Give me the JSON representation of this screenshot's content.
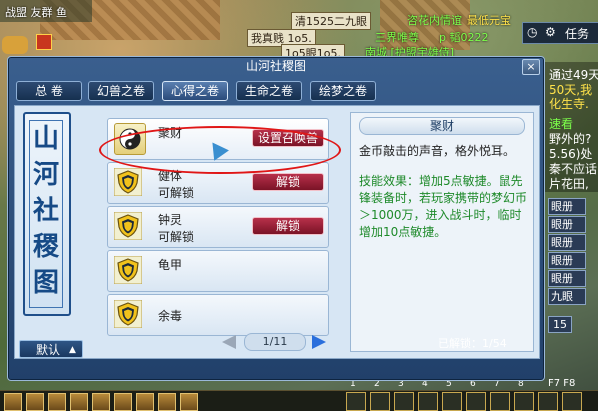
{
  "scene": {
    "top_left_text": "战盟 友群 鱼",
    "plates": [
      "清1525二九眼",
      "我真贱 1o5.",
      "1o5眼1o5."
    ],
    "green_texts": [
      "咨花内情谊",
      "三界唯尊",
      "p 韬0222",
      "南城 [护盟宇雄侍]"
    ],
    "yellow_texts": [
      "最低元宝"
    ],
    "right_panel": {
      "top_bar": [
        "任务"
      ],
      "chat_lines": [
        {
          "text": "通过49天",
          "color": "#ffffff"
        },
        {
          "text": "50天,我",
          "color": "#ffe24a"
        },
        {
          "text": "化生寺.",
          "color": "#ffe24a"
        },
        {
          "text": "速看",
          "color": "#7cff4a"
        },
        {
          "text": "野外的?",
          "color": "#ffffff"
        },
        {
          "text": "5.56)处",
          "color": "#ffffff"
        },
        {
          "text": "秦不应话",
          "color": "#ffffff"
        },
        {
          "text": "片花田,",
          "color": "#ffffff"
        }
      ],
      "quest_items": [
        "眼册",
        "眼册",
        "眼册",
        "眼册",
        "眼册",
        "九眼"
      ],
      "badge": "15",
      "fkeys": "F7 F8"
    },
    "hotbar_numbers": [
      "1",
      "2",
      "3",
      "4",
      "5",
      "6",
      "7",
      "8"
    ]
  },
  "dialog": {
    "title": "山河社稷图",
    "close_label": "×",
    "tabs": [
      {
        "label": "总 卷",
        "active": false
      },
      {
        "label": "幻兽之卷",
        "active": false
      },
      {
        "label": "心得之卷",
        "active": true
      },
      {
        "label": "生命之卷",
        "active": false
      },
      {
        "label": "绘梦之卷",
        "active": false
      }
    ],
    "banner": [
      "山",
      "河",
      "社",
      "稷",
      "图"
    ],
    "collapse_label": "默认",
    "skills": [
      {
        "name": "聚财",
        "status": "",
        "button": "设置召唤兽",
        "icon": "yinyang-icon",
        "selected": true
      },
      {
        "name": "健体",
        "status": "可解锁",
        "button": "解锁",
        "icon": "shield-icon",
        "selected": false
      },
      {
        "name": "钟灵",
        "status": "可解锁",
        "button": "解锁",
        "icon": "shield-icon",
        "selected": false
      },
      {
        "name": "龟甲",
        "status": "",
        "button": "",
        "icon": "shield-icon",
        "selected": false
      },
      {
        "name": "余毒",
        "status": "",
        "button": "",
        "icon": "shield-icon",
        "selected": false
      }
    ],
    "detail": {
      "title": "聚财",
      "description": "金币敲击的声音，格外悦耳。",
      "effect": "技能效果：增加5点敏捷。鼠先锋装备时，若玩家携带的梦幻币＞1000万，进入战斗时，临时增加10点敏捷。"
    },
    "pager": {
      "text": "1/11"
    },
    "unlocked": "已解锁：1/54"
  },
  "colors": {
    "dialog_bg": "#2a4b7a",
    "accent_red": "#9a1f36",
    "effect_green": "#1e8a2a",
    "highlight_ring": "#e01616"
  }
}
